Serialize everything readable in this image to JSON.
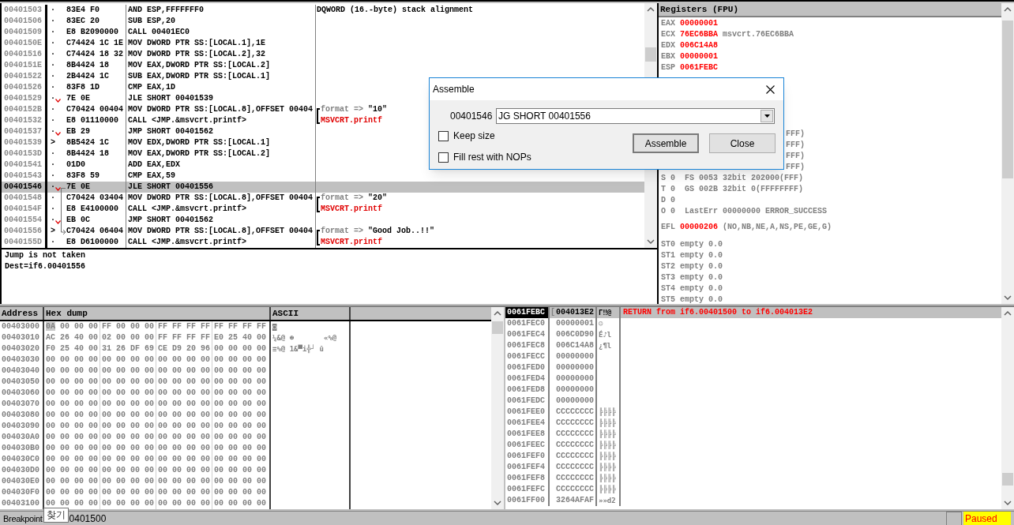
{
  "disassembly": {
    "rows": [
      {
        "address": "00401503",
        "marker": "·",
        "jump": false,
        "hex": "83E4 F0",
        "asm": "AND ESP,FFFFFFF0",
        "selected": false,
        "comment": {
          "kind": "plain",
          "text": "DQWORD (16.-byte) stack alignment"
        }
      },
      {
        "address": "00401506",
        "marker": "·",
        "jump": false,
        "hex": "83EC 20",
        "asm": "SUB ESP,20",
        "selected": false
      },
      {
        "address": "00401509",
        "marker": "·",
        "jump": false,
        "hex": "E8 B2090000",
        "asm": "CALL 00401EC0",
        "selected": false
      },
      {
        "address": "0040150E",
        "marker": "·",
        "jump": false,
        "hex": "C74424 1C 1E",
        "asm": "MOV DWORD PTR SS:[LOCAL.1],1E",
        "selected": false
      },
      {
        "address": "00401516",
        "marker": "·",
        "jump": false,
        "hex": "C74424 18 32",
        "asm": "MOV DWORD PTR SS:[LOCAL.2],32",
        "selected": false
      },
      {
        "address": "0040151E",
        "marker": "·",
        "jump": false,
        "hex": "8B4424 18",
        "asm": "MOV EAX,DWORD PTR SS:[LOCAL.2]",
        "selected": false
      },
      {
        "address": "00401522",
        "marker": "·",
        "jump": false,
        "hex": "2B4424 1C",
        "asm": "SUB EAX,DWORD PTR SS:[LOCAL.1]",
        "selected": false
      },
      {
        "address": "00401526",
        "marker": "·",
        "jump": false,
        "hex": "83F8 1D",
        "asm": "CMP EAX,1D",
        "selected": false
      },
      {
        "address": "00401529",
        "marker": "·",
        "jump": true,
        "hex": "7E 0E",
        "asm": "JLE SHORT 00401539",
        "selected": false
      },
      {
        "address": "0040152B",
        "marker": "·",
        "jump": false,
        "hex": "C70424 00404",
        "asm": "MOV DWORD PTR SS:[LOCAL.8],OFFSET 00404",
        "selected": false,
        "comment": {
          "kind": "arg",
          "label": "format =>",
          "value": "\"10\""
        }
      },
      {
        "address": "00401532",
        "marker": "·",
        "jump": false,
        "hex": "E8 01110000",
        "asm": "CALL <JMP.&msvcrt.printf>",
        "selected": false,
        "comment": {
          "kind": "call",
          "text": "MSVCRT.printf"
        }
      },
      {
        "address": "00401537",
        "marker": "·",
        "jump": true,
        "hex": "EB 29",
        "asm": "JMP SHORT 00401562",
        "selected": false
      },
      {
        "address": "00401539",
        "marker": ">",
        "jump": false,
        "hex": "8B5424 1C",
        "asm": "MOV EDX,DWORD PTR SS:[LOCAL.1]",
        "selected": false
      },
      {
        "address": "0040153D",
        "marker": "·",
        "jump": false,
        "hex": "8B4424 18",
        "asm": "MOV EAX,DWORD PTR SS:[LOCAL.2]",
        "selected": false
      },
      {
        "address": "00401541",
        "marker": "·",
        "jump": false,
        "hex": "01D0",
        "asm": "ADD EAX,EDX",
        "selected": false
      },
      {
        "address": "00401543",
        "marker": "·",
        "jump": false,
        "hex": "83F8 59",
        "asm": "CMP EAX,59",
        "selected": false
      },
      {
        "address": "00401546",
        "marker": "·",
        "jump": true,
        "hex": "7E 0E",
        "asm": "JLE SHORT 00401556",
        "selected": true,
        "jump_from": true
      },
      {
        "address": "00401548",
        "marker": "·",
        "jump": false,
        "hex": "C70424 03404",
        "asm": "MOV DWORD PTR SS:[LOCAL.8],OFFSET 00404",
        "selected": false,
        "comment": {
          "kind": "arg",
          "label": "format =>",
          "value": "\"20\""
        }
      },
      {
        "address": "0040154F",
        "marker": "·",
        "jump": false,
        "hex": "E8 E4100000",
        "asm": "CALL <JMP.&msvcrt.printf>",
        "selected": false,
        "comment": {
          "kind": "call",
          "text": "MSVCRT.printf"
        }
      },
      {
        "address": "00401554",
        "marker": "·",
        "jump": true,
        "hex": "EB 0C",
        "asm": "JMP SHORT 00401562",
        "selected": false
      },
      {
        "address": "00401556",
        "marker": ">",
        "jump": false,
        "hex": "C70424 06404",
        "asm": "MOV DWORD PTR SS:[LOCAL.8],OFFSET 00404",
        "selected": false,
        "jump_to": true,
        "comment": {
          "kind": "arg",
          "label": "format =>",
          "value": "\"Good Job..!!\""
        }
      },
      {
        "address": "0040155D",
        "marker": "·",
        "jump": false,
        "hex": "E8 D6100000",
        "asm": "CALL <JMP.&msvcrt.printf>",
        "selected": false,
        "comment": {
          "kind": "call",
          "text": "MSVCRT.printf"
        }
      }
    ]
  },
  "info": [
    "Jump is not taken",
    "Dest=if6.00401556"
  ],
  "registers": {
    "title": "Registers (FPU)",
    "general": [
      {
        "name": "EAX",
        "value": "00000001",
        "changed": true
      },
      {
        "name": "ECX",
        "value": "76EC6BBA",
        "changed": true,
        "note": "msvcrt.76EC6BBA"
      },
      {
        "name": "EDX",
        "value": "006C14A8",
        "changed": true
      },
      {
        "name": "EBX",
        "value": "00000001",
        "changed": true
      },
      {
        "name": "ESP",
        "value": "0061FEBC",
        "changed": true
      }
    ],
    "segment_tails": [
      "FFF)",
      "FFF)",
      "FFF)",
      "FFF)"
    ],
    "flags": [
      {
        "flag": "S",
        "bit": "0",
        "text": "FS 0053 32bit 202000(FFF)"
      },
      {
        "flag": "T",
        "bit": "0",
        "text": "GS 002B 32bit 0(FFFFFFFF)"
      },
      {
        "flag": "D",
        "bit": "0"
      },
      {
        "flag": "O",
        "bit": "0",
        "text": "LastErr 00000000 ERROR_SUCCESS"
      }
    ],
    "efl": {
      "label": "EFL",
      "value": "00000206",
      "changed": true,
      "decoded": "(NO,NB,NE,A,NS,PE,GE,G)"
    },
    "fpu": [
      {
        "name": "ST0",
        "text": "empty 0.0"
      },
      {
        "name": "ST1",
        "text": "empty 0.0"
      },
      {
        "name": "ST2",
        "text": "empty 0.0"
      },
      {
        "name": "ST3",
        "text": "empty 0.0"
      },
      {
        "name": "ST4",
        "text": "empty 0.0"
      },
      {
        "name": "ST5",
        "text": "empty 0.0"
      }
    ]
  },
  "dump": {
    "columns": [
      "Address",
      "Hex dump",
      "ASCII"
    ],
    "rows": [
      {
        "address": "00403000",
        "groups": [
          "0A 00 00 00",
          "FF 00 00 00",
          "FF FF FF FF",
          "FF FF FF FF"
        ],
        "ascii": "◙",
        "cursor": true
      },
      {
        "address": "00403010",
        "groups": [
          "AC 26 40 00",
          "02 00 00 00",
          "FF FF FF FF",
          "E0 25 40 00"
        ],
        "ascii": "¼&@ ☻       «%@",
        "cursor": false
      },
      {
        "address": "00403020",
        "groups": [
          "F0 25 40 00",
          "31 26 DF 69",
          "CE D9 20 96",
          "00 00 00 00"
        ],
        "ascii": "≡%@ 1&▀i╬┘ û",
        "cursor": false
      },
      {
        "address": "00403030",
        "groups": [
          "00 00 00 00",
          "00 00 00 00",
          "00 00 00 00",
          "00 00 00 00"
        ],
        "cursor": false
      },
      {
        "address": "00403040",
        "groups": [
          "00 00 00 00",
          "00 00 00 00",
          "00 00 00 00",
          "00 00 00 00"
        ],
        "cursor": false
      },
      {
        "address": "00403050",
        "groups": [
          "00 00 00 00",
          "00 00 00 00",
          "00 00 00 00",
          "00 00 00 00"
        ],
        "cursor": false
      },
      {
        "address": "00403060",
        "groups": [
          "00 00 00 00",
          "00 00 00 00",
          "00 00 00 00",
          "00 00 00 00"
        ],
        "cursor": false
      },
      {
        "address": "00403070",
        "groups": [
          "00 00 00 00",
          "00 00 00 00",
          "00 00 00 00",
          "00 00 00 00"
        ],
        "cursor": false
      },
      {
        "address": "00403080",
        "groups": [
          "00 00 00 00",
          "00 00 00 00",
          "00 00 00 00",
          "00 00 00 00"
        ],
        "cursor": false
      },
      {
        "address": "00403090",
        "groups": [
          "00 00 00 00",
          "00 00 00 00",
          "00 00 00 00",
          "00 00 00 00"
        ],
        "cursor": false
      },
      {
        "address": "004030A0",
        "groups": [
          "00 00 00 00",
          "00 00 00 00",
          "00 00 00 00",
          "00 00 00 00"
        ],
        "cursor": false
      },
      {
        "address": "004030B0",
        "groups": [
          "00 00 00 00",
          "00 00 00 00",
          "00 00 00 00",
          "00 00 00 00"
        ],
        "cursor": false
      },
      {
        "address": "004030C0",
        "groups": [
          "00 00 00 00",
          "00 00 00 00",
          "00 00 00 00",
          "00 00 00 00"
        ],
        "cursor": false
      },
      {
        "address": "004030D0",
        "groups": [
          "00 00 00 00",
          "00 00 00 00",
          "00 00 00 00",
          "00 00 00 00"
        ],
        "cursor": false
      },
      {
        "address": "004030E0",
        "groups": [
          "00 00 00 00",
          "00 00 00 00",
          "00 00 00 00",
          "00 00 00 00"
        ],
        "cursor": false
      },
      {
        "address": "004030F0",
        "groups": [
          "00 00 00 00",
          "00 00 00 00",
          "00 00 00 00",
          "00 00 00 00"
        ],
        "cursor": false
      },
      {
        "address": "00403100",
        "groups": [
          "00 00 00 00",
          "00 00 00 00",
          "00 00 00 00",
          "00 00 00 00"
        ],
        "cursor": false
      }
    ]
  },
  "stack": {
    "rows": [
      {
        "address": "0061FEBC",
        "bracket": "[",
        "value": "004013E2",
        "ascii": "Γ‼@",
        "comment": "RETURN from if6.00401500 to if6.004013E2",
        "selected": true
      },
      {
        "address": "0061FEC0",
        "value": "00000001",
        "ascii": "☺",
        "selected": false
      },
      {
        "address": "0061FEC4",
        "value": "006C0D90",
        "ascii": "É♪l",
        "selected": false
      },
      {
        "address": "0061FEC8",
        "value": "006C14A8",
        "ascii": "¿¶l",
        "selected": false
      },
      {
        "address": "0061FECC",
        "value": "00000000",
        "selected": false
      },
      {
        "address": "0061FED0",
        "value": "00000000",
        "selected": false
      },
      {
        "address": "0061FED4",
        "value": "00000000",
        "selected": false
      },
      {
        "address": "0061FED8",
        "value": "00000000",
        "selected": false
      },
      {
        "address": "0061FEDC",
        "value": "00000000",
        "selected": false
      },
      {
        "address": "0061FEE0",
        "value": "CCCCCCCC",
        "ascii": "╠╠╠╠",
        "selected": false
      },
      {
        "address": "0061FEE4",
        "value": "CCCCCCCC",
        "ascii": "╠╠╠╠",
        "selected": false
      },
      {
        "address": "0061FEE8",
        "value": "CCCCCCCC",
        "ascii": "╠╠╠╠",
        "selected": false
      },
      {
        "address": "0061FEEC",
        "value": "CCCCCCCC",
        "ascii": "╠╠╠╠",
        "selected": false
      },
      {
        "address": "0061FEF0",
        "value": "CCCCCCCC",
        "ascii": "╠╠╠╠",
        "selected": false
      },
      {
        "address": "0061FEF4",
        "value": "CCCCCCCC",
        "ascii": "╠╠╠╠",
        "selected": false
      },
      {
        "address": "0061FEF8",
        "value": "CCCCCCCC",
        "ascii": "╠╠╠╠",
        "selected": false
      },
      {
        "address": "0061FEFC",
        "value": "CCCCCCCC",
        "ascii": "╠╠╠╠",
        "selected": false
      },
      {
        "address": "0061FF00",
        "value": "3264AFAF",
        "ascii": "»»d2",
        "selected": false
      }
    ]
  },
  "status_bar": {
    "message_start": "Breakpoint",
    "message_end": "0401500",
    "state": "Paused"
  },
  "tooltip": "찾기",
  "dialog": {
    "title": "Assemble",
    "address": "00401546",
    "instruction": "JG SHORT 00401556",
    "options": [
      {
        "label": "Keep size",
        "checked": false
      },
      {
        "label": "Fill rest with NOPs",
        "checked": false
      }
    ],
    "buttons": [
      {
        "label": "Assemble",
        "default": true
      },
      {
        "label": "Close",
        "default": false
      }
    ]
  }
}
